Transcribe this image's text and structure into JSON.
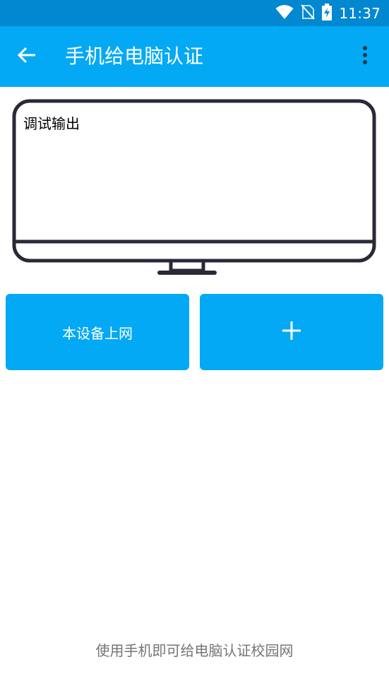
{
  "status_bar": {
    "time": "11:37",
    "icons": [
      "wifi-icon",
      "no-sim-icon",
      "battery-charging-icon"
    ]
  },
  "app_bar": {
    "title": "手机给电脑认证",
    "back_icon": "arrow-back-icon",
    "overflow_icon": "more-vert-icon"
  },
  "monitor": {
    "debug_output_label": "调试输出"
  },
  "actions": {
    "online_button_label": "本设备上网",
    "add_button_label": "+"
  },
  "footer": {
    "hint": "使用手机即可给电脑认证校园网"
  },
  "colors": {
    "status_bar": "#0288d1",
    "primary": "#03a9f4",
    "monitor_outline": "#2b2838",
    "footer_text": "#757575"
  }
}
